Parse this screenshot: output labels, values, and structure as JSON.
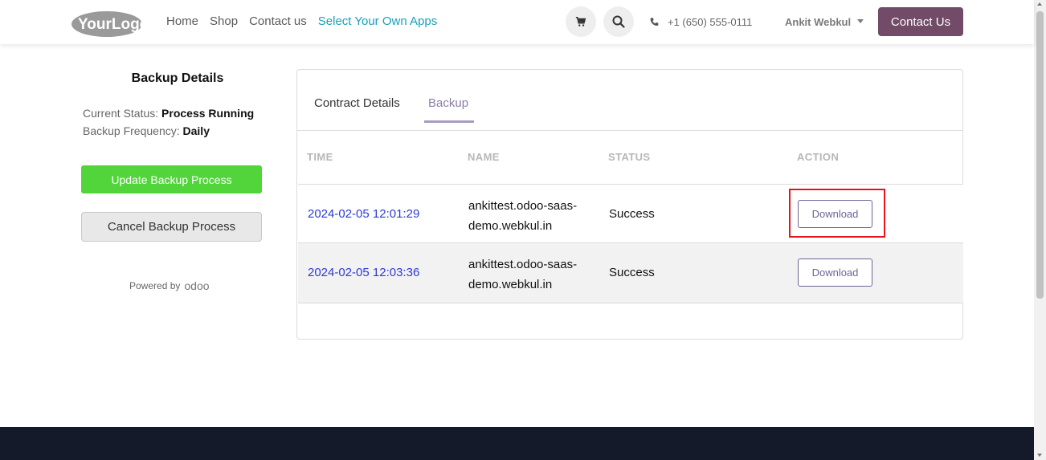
{
  "header": {
    "logo_text": "YourLogo",
    "nav": [
      "Home",
      "Shop",
      "Contact us",
      "Select Your Own Apps"
    ],
    "cart_icon": "cart-icon",
    "search_icon": "search-icon",
    "phone": "+1 (650) 555-0111",
    "user": "Ankit Webkul",
    "contact_button": "Contact Us",
    "accent_color": "#714b67"
  },
  "left_panel": {
    "title": "Backup Details",
    "current_status_label": "Current Status:",
    "current_status_value": "Process Running",
    "frequency_label": "Backup Frequency:",
    "frequency_value": "Daily",
    "update_button": "Update Backup Process",
    "cancel_button": "Cancel Backup Process",
    "powered_by": "Powered by",
    "powered_brand": "odoo"
  },
  "tabs": [
    "Contract Details",
    "Backup"
  ],
  "table": {
    "headers": [
      "TIME",
      "NAME",
      "STATUS",
      "ACTION"
    ],
    "rows": [
      {
        "time": "2024-02-05 12:01:29",
        "name": "ankittest.odoo-saas-demo.webkul.in",
        "status": "Success",
        "action": "Download"
      },
      {
        "time": "2024-02-05 12:03:36",
        "name": "ankittest.odoo-saas-demo.webkul.in",
        "status": "Success",
        "action": "Download"
      }
    ]
  }
}
